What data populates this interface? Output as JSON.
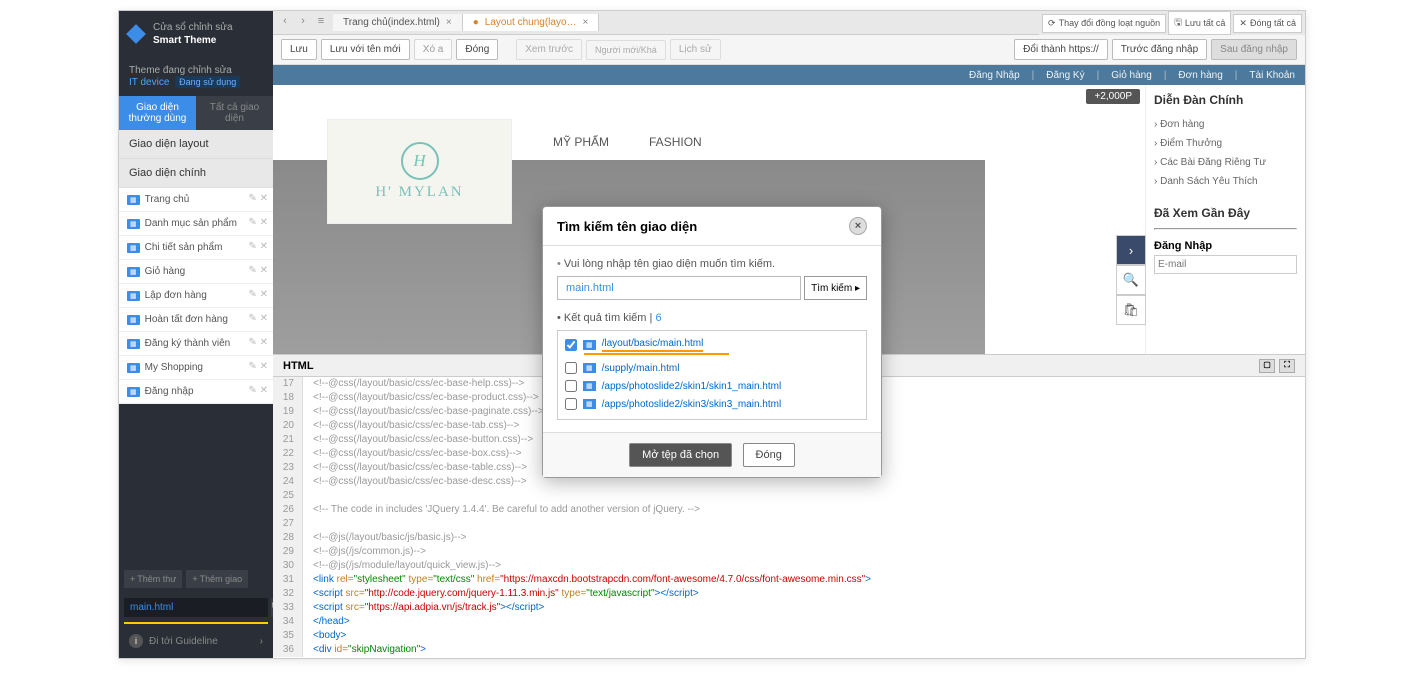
{
  "sidebar": {
    "title_line1": "Cửa sổ chỉnh sửa",
    "title_line2": "Smart Theme",
    "theme_editing": "Theme đang chỉnh sửa",
    "theme_name": "IT device",
    "theme_status": "Đang sử dụng",
    "tabs": {
      "common": "Giao diện thường dùng",
      "all": "Tất cả giao diện"
    },
    "section_layout": "Giao diện layout",
    "section_main": "Giao diện chính",
    "items": [
      {
        "label": "Trang chủ"
      },
      {
        "label": "Danh mục sản phẩm"
      },
      {
        "label": "Chi tiết sản phẩm"
      },
      {
        "label": "Giỏ hàng"
      },
      {
        "label": "Lập đơn hàng"
      },
      {
        "label": "Hoàn tất đơn hàng"
      },
      {
        "label": "Đăng ký thành viên"
      },
      {
        "label": "My Shopping"
      },
      {
        "label": "Đăng nhập"
      }
    ],
    "add_folder": "Thêm thư",
    "add_interface": "Thêm giao",
    "search_value": "main.html",
    "guideline": "Đi tới Guideline"
  },
  "tabs": {
    "home": "Trang chủ(index.html)",
    "layout": "Layout chung(layo…"
  },
  "top_right": {
    "sync": "Thay đổi đồng loạt nguồn",
    "save_all": "Lưu tất cả",
    "close_all": "Đóng tất cả"
  },
  "toolbar": {
    "save": "Lưu",
    "save_as": "Lưu với tên mới",
    "delete": "Xó a",
    "close": "Đóng",
    "preview": "Xem trước",
    "placeholder": "Người mới/Khá",
    "history": "Lịch sử",
    "https": "Đổi thành https://",
    "before_login": "Trước đăng nhập",
    "after_login": "Sau đăng nhập"
  },
  "site": {
    "header": [
      "Đăng Nhập",
      "Đăng Ký",
      "Giỏ hàng",
      "Đơn hàng",
      "Tài Khoản"
    ],
    "points": "+2,000P",
    "nav": [
      "MỸ PHẨM",
      "FASHION"
    ],
    "logo": {
      "initial": "H",
      "text": "H' MYLAN"
    },
    "right_panel": {
      "title": "Diễn Đàn Chính",
      "items": [
        "Đơn hàng",
        "Điểm Thưởng",
        "Các Bài Đăng Riêng Tư",
        "Danh Sách Yêu Thích"
      ],
      "recent": "Đã Xem Gần Đây",
      "login_title": "Đăng Nhập",
      "email_placeholder": "E-mail"
    }
  },
  "editor": {
    "title": "HTML",
    "lines": [
      {
        "n": 17,
        "t": "<!--@css(/layout/basic/css/ec-base-help.css)-->",
        "cls": "c-comment"
      },
      {
        "n": 18,
        "t": "<!--@css(/layout/basic/css/ec-base-product.css)-->",
        "cls": "c-comment"
      },
      {
        "n": 19,
        "t": "<!--@css(/layout/basic/css/ec-base-paginate.css)-->",
        "cls": "c-comment"
      },
      {
        "n": 20,
        "t": "<!--@css(/layout/basic/css/ec-base-tab.css)-->",
        "cls": "c-comment"
      },
      {
        "n": 21,
        "t": "<!--@css(/layout/basic/css/ec-base-button.css)-->",
        "cls": "c-comment"
      },
      {
        "n": 22,
        "t": "<!--@css(/layout/basic/css/ec-base-box.css)-->",
        "cls": "c-comment"
      },
      {
        "n": 23,
        "t": "<!--@css(/layout/basic/css/ec-base-table.css)-->",
        "cls": "c-comment"
      },
      {
        "n": 24,
        "t": "<!--@css(/layout/basic/css/ec-base-desc.css)-->",
        "cls": "c-comment"
      },
      {
        "n": 25,
        "t": "",
        "cls": ""
      },
      {
        "n": 26,
        "t": "<!-- The code in includes 'JQuery 1.4.4'. Be careful to add another version of jQuery. -->",
        "cls": "c-comment"
      },
      {
        "n": 27,
        "t": "",
        "cls": ""
      },
      {
        "n": 28,
        "t": "<!--@js(/layout/basic/js/basic.js)-->",
        "cls": "c-comment"
      },
      {
        "n": 29,
        "t": "<!--@js(/js/common.js)-->",
        "cls": "c-comment"
      },
      {
        "n": 30,
        "t": "<!--@js(/js/module/layout/quick_view.js)-->",
        "cls": "c-comment"
      },
      {
        "n": 31,
        "t": "link_line",
        "cls": "special1"
      },
      {
        "n": 32,
        "t": "script_line1",
        "cls": "special2"
      },
      {
        "n": 33,
        "t": "script_line2",
        "cls": "special3"
      },
      {
        "n": 34,
        "t": "</head>",
        "cls": "c-tag"
      },
      {
        "n": 35,
        "t": "<body>",
        "cls": "c-tag"
      },
      {
        "n": 36,
        "t": "div_line",
        "cls": "special4"
      }
    ]
  },
  "modal": {
    "title": "Tìm kiếm tên giao diện",
    "prompt": "Vui lòng nhập tên giao diện muốn tìm kiếm.",
    "input_value": "main.html",
    "search_btn": "Tìm kiếm ▸",
    "results_label": "Kết quả tìm kiếm",
    "results_count": "6",
    "results": [
      {
        "path": "/layout/basic/main.html",
        "checked": true
      },
      {
        "path": "/supply/main.html",
        "checked": false
      },
      {
        "path": "/apps/photoslide2/skin1/skin1_main.html",
        "checked": false
      },
      {
        "path": "/apps/photoslide2/skin3/skin3_main.html",
        "checked": false
      }
    ],
    "open_btn": "Mở tệp đã chọn",
    "close_btn": "Đóng"
  }
}
